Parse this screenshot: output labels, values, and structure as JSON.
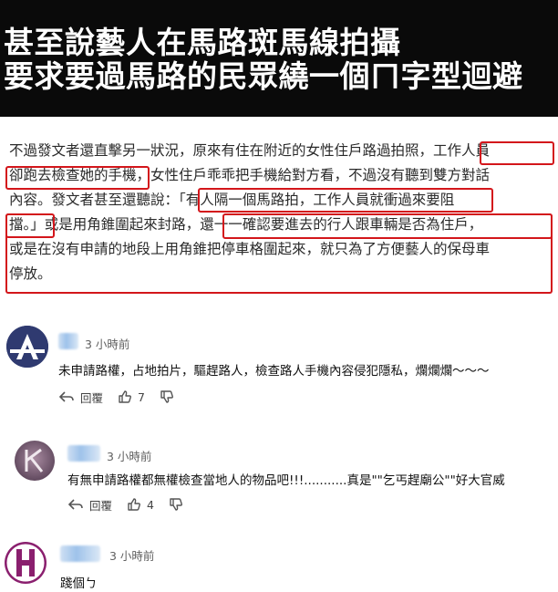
{
  "banner": {
    "line1": "甚至說藝人在馬路斑馬線拍攝",
    "line2": "要求要過馬路的民眾繞一個ㄇ字型迴避"
  },
  "article": {
    "line1a": "不過發文者還直擊另一狀況，原來有住在附近的女性住戶路過拍照，",
    "line1b": "工作人員",
    "line2a": "卻跑去檢查她的手機",
    "line2b": "，女性住戶乖乖把手機給對方看，不過沒有聽到雙方對話",
    "line3a": "內容。發文者甚至還聽說：",
    "line3b": "「有人隔一個馬路拍，工作人員就衝過來要阻",
    "line4a": "擋。」",
    "line4b": "或是用角錐圍起來封路，",
    "line4c": "還一一確認要進去的行人跟車輛是否為住戶，",
    "line5": "或是在沒有申請的地段上用角錐把停車格圍起來，就只為了方便藝人的保母車",
    "line6": "停放。"
  },
  "comments": [
    {
      "avatar_letter": "A",
      "time": "3 小時前",
      "text": "未申請路權，占地拍片，驅趕路人，檢查路人手機內容侵犯隱私，爛爛爛～～～",
      "reply_label": "回覆",
      "likes": "7"
    },
    {
      "avatar_letter": "K",
      "time": "3 小時前",
      "text": "有無申請路權都無權檢查當地人的物品吧!!!...........真是\"\"乞丐趕廟公\"\"好大官威",
      "reply_label": "回覆",
      "likes": "4"
    },
    {
      "avatar_letter": "H",
      "time": "3 小時前",
      "text": "踐個ㄅ"
    }
  ],
  "colors": {
    "highlight": "#d3161b",
    "banner_bg": "#0a0a0a",
    "avatar_a": "#2f3a70",
    "avatar_k": "#6b5268",
    "avatar_h": "#8a1f6e"
  }
}
